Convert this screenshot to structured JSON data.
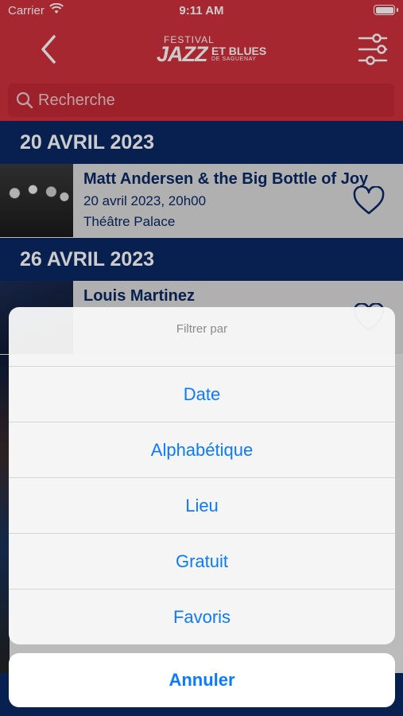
{
  "status_bar": {
    "carrier": "Carrier",
    "time": "9:11 AM"
  },
  "header": {
    "logo": {
      "line1": "FESTIVAL",
      "line2": "JAZZ",
      "line3": "ET BLUES",
      "line4": "DE SAGUENAY"
    },
    "brand_color": "#d0313d"
  },
  "search": {
    "placeholder": "Recherche"
  },
  "sections": [
    {
      "date_header": "20 AVRIL 2023",
      "events": [
        {
          "title": "Matt Andersen & the Big Bottle of Joy",
          "datetime": "20 avril 2023, 20h00",
          "venue": "Théâtre Palace"
        }
      ]
    },
    {
      "date_header": "26 AVRIL 2023",
      "events": [
        {
          "title": "Louis Martinez"
        }
      ]
    }
  ],
  "action_sheet": {
    "title": "Filtrer par",
    "options": [
      "Date",
      "Alphabétique",
      "Lieu",
      "Gratuit",
      "Favoris"
    ],
    "cancel": "Annuler"
  },
  "colors": {
    "navy": "#0b2964",
    "action_blue": "#0a7bff"
  }
}
